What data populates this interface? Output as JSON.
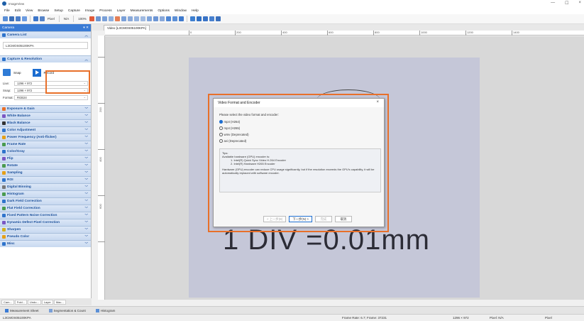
{
  "titlebar": {
    "title": "ImageView",
    "min": "—",
    "max": "☐",
    "close": "×"
  },
  "menubar": [
    "File",
    "Edit",
    "View",
    "Browse",
    "Setup",
    "Capture",
    "Image",
    "Process",
    "Layer",
    "Measurements",
    "Options",
    "Window",
    "Help"
  ],
  "toolbar": {
    "unit": "Pixel",
    "calib": "N/A",
    "zoom": "100%"
  },
  "left": {
    "header": "Camera",
    "camera_list": {
      "title": "Camera List",
      "item": "L3CMOS05100KPA"
    },
    "capture": {
      "title": "Capture & Resolution",
      "snap_label": "Snap",
      "record_label": "Record",
      "live_label": "Live:",
      "live_value": "1296 × 972",
      "snap_field_label": "Snap:",
      "snap_value": "1296 × 972",
      "format_label": "Format:",
      "format_value": "RGB24"
    },
    "sections": [
      "Exposure & Gain",
      "White Balance",
      "Black Balance",
      "Color Adjustment",
      "Power Frequency (Anti-flicker)",
      "Frame Rate",
      "Color/Gray",
      "Flip",
      "Rotate",
      "Sampling",
      "ROI",
      "Digital Binning",
      "Histogram",
      "Dark Field Correction",
      "Flat Field Correction",
      "Fixed Pattern Noise Correction",
      "Dynamic Defect Pixel Correction",
      "Sharpen",
      "Pseudo Color",
      "Misc"
    ],
    "bottom_tabs": [
      "Cam...",
      "Fold...",
      "Undo...",
      "Layer",
      "Mac..."
    ]
  },
  "video": {
    "tab_title": "Video [L3CMOS05100KPA]",
    "ruler_labels": [
      "200",
      "400",
      "600",
      "800",
      "1000",
      "1200",
      "1400"
    ],
    "ruler_left_labels": [
      "200",
      "400",
      "600"
    ],
    "image_text": "1 DIV =0.01mm"
  },
  "dialog": {
    "title": "Video Format and Encoder",
    "close": "×",
    "prompt": "Please select the video format and encoder:",
    "options": [
      "mp4 (H264)",
      "mp4 (H265)",
      "wmv (Deprecated)",
      "avi (Deprecated)"
    ],
    "selected_index": 0,
    "tips_title": "Tips:",
    "tips_line1": "Available hardware (GPU) encoder is:",
    "tips_hw1": "1. Intel(R) Quick Sync Video H.264 Encoder",
    "tips_hw2": "2. Intel(R) Hardware H265 Encoder",
    "tips_line2": "Hardware (GPU) encoder can reduce CPU usage significantly, but if the resolution exceeds the GPU's capability, it will be automatically replaced with software encoder.",
    "btn_back": "< 上一步(B)",
    "btn_next": "下一步(N) >",
    "btn_finish": "完成",
    "btn_cancel": "取消"
  },
  "bottom_strip": [
    "Measurement Sheet",
    "Segmentation & Count",
    "Histogram"
  ],
  "status": {
    "camera": "L3CMOS05100KPA",
    "frame": "Frame Rate: 6.7; Frame: 37231",
    "res": "1296 × 972",
    "pixel": "Pixel: N/A",
    "unit": "Pixel"
  },
  "colors": {
    "accent": "#e8702a",
    "blue": "#3a7bd5"
  }
}
